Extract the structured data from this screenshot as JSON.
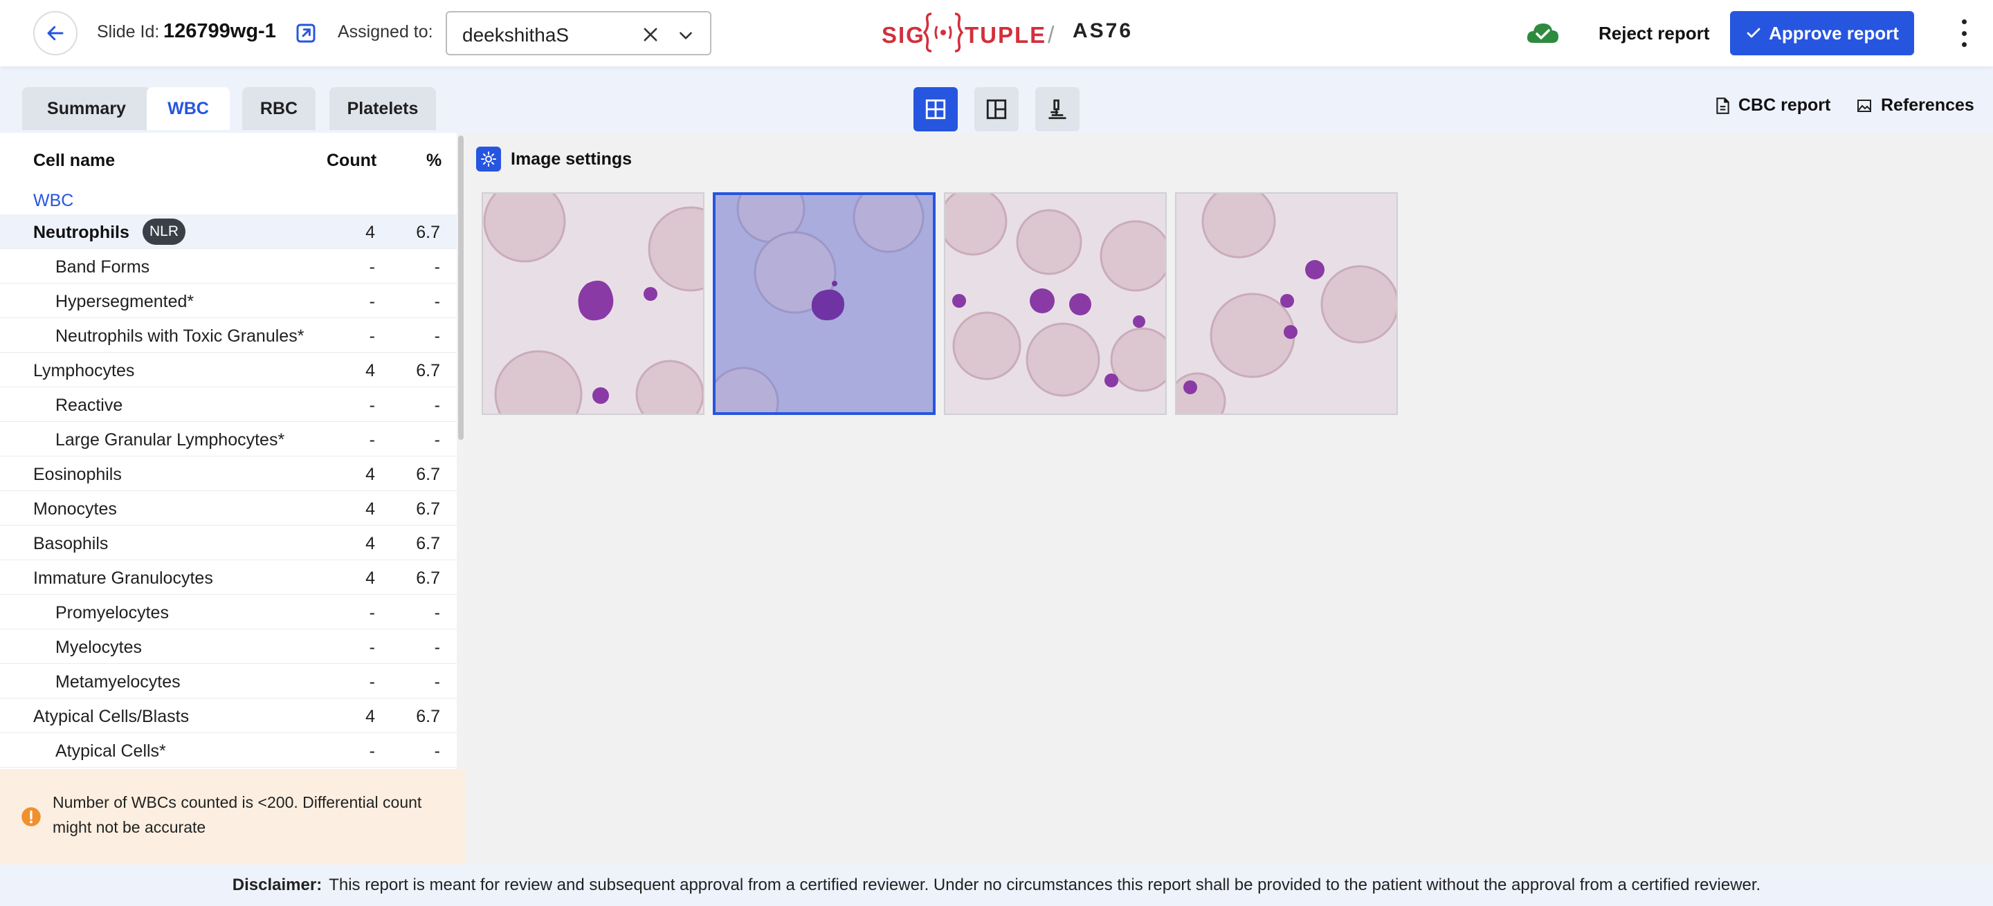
{
  "header": {
    "slide_label": "Slide Id:",
    "slide_id": "126799wg-1",
    "assigned_label": "Assigned to:",
    "assigned_value": "deekshithaS",
    "logo_left": "SIG",
    "logo_right": "TUPLE",
    "logo_slash": "/",
    "logo_model": "AS76",
    "reject_label": "Reject report",
    "approve_label": "Approve report",
    "accent_color": "#2655e0"
  },
  "tabs": [
    {
      "label": "Summary",
      "active": false
    },
    {
      "label": "WBC",
      "active": true
    },
    {
      "label": "RBC",
      "active": false
    },
    {
      "label": "Platelets",
      "active": false
    }
  ],
  "subbar": {
    "cbc_label": "CBC report",
    "references_label": "References"
  },
  "table": {
    "col_name": "Cell name",
    "col_count": "Count",
    "col_pct": "%",
    "group_label": "WBC",
    "badge": "NLR",
    "rows": [
      {
        "name": "Neutrophils",
        "count": "4",
        "pct": "6.7",
        "level": 0
      },
      {
        "name": "Band Forms",
        "count": "-",
        "pct": "-",
        "level": 1
      },
      {
        "name": "Hypersegmented*",
        "count": "-",
        "pct": "-",
        "level": 1
      },
      {
        "name": "Neutrophils with Toxic Granules*",
        "count": "-",
        "pct": "-",
        "level": 1
      },
      {
        "name": "Lymphocytes",
        "count": "4",
        "pct": "6.7",
        "level": 0
      },
      {
        "name": "Reactive",
        "count": "-",
        "pct": "-",
        "level": 1
      },
      {
        "name": "Large Granular Lymphocytes*",
        "count": "-",
        "pct": "-",
        "level": 1
      },
      {
        "name": "Eosinophils",
        "count": "4",
        "pct": "6.7",
        "level": 0
      },
      {
        "name": "Monocytes",
        "count": "4",
        "pct": "6.7",
        "level": 0
      },
      {
        "name": "Basophils",
        "count": "4",
        "pct": "6.7",
        "level": 0
      },
      {
        "name": "Immature Granulocytes",
        "count": "4",
        "pct": "6.7",
        "level": 0
      },
      {
        "name": "Promyelocytes",
        "count": "-",
        "pct": "-",
        "level": 1
      },
      {
        "name": "Myelocytes",
        "count": "-",
        "pct": "-",
        "level": 1
      },
      {
        "name": "Metamyelocytes",
        "count": "-",
        "pct": "-",
        "level": 1
      },
      {
        "name": "Atypical Cells/Blasts",
        "count": "4",
        "pct": "6.7",
        "level": 0
      },
      {
        "name": "Atypical Cells*",
        "count": "-",
        "pct": "-",
        "level": 1
      }
    ]
  },
  "warning": {
    "text": "Number of WBCs counted is <200. Differential count might not be accurate"
  },
  "images": {
    "settings_label": "Image settings",
    "selected_index": 1
  },
  "footer": {
    "label": "Disclaimer:",
    "text": "This report is meant for review and subsequent approval from a certified reviewer. Under no circumstances this report shall be provided to the patient without the approval from a certified reviewer."
  }
}
